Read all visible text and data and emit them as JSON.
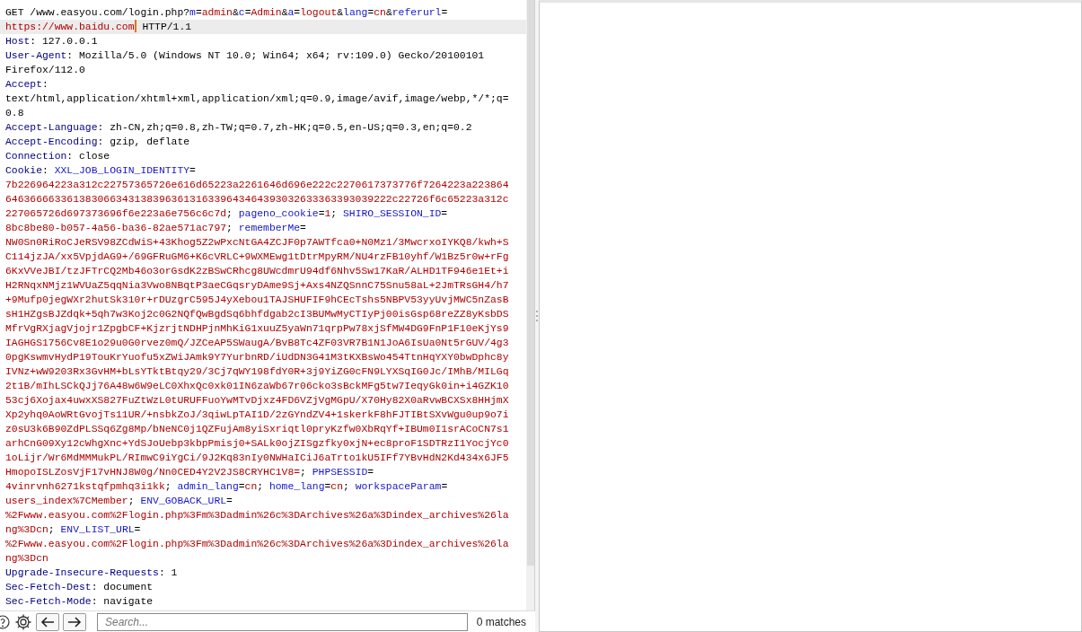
{
  "editor": {
    "lines": [
      {
        "highlighted": false,
        "segments": [
          {
            "kind": "plain",
            "text": "GET /www.easyou.com/login.php?"
          },
          {
            "kind": "name",
            "text": "m"
          },
          {
            "kind": "plain",
            "text": "="
          },
          {
            "kind": "value",
            "text": "admin"
          },
          {
            "kind": "plain",
            "text": "&"
          },
          {
            "kind": "name",
            "text": "c"
          },
          {
            "kind": "plain",
            "text": "="
          },
          {
            "kind": "value",
            "text": "Admin"
          },
          {
            "kind": "plain",
            "text": "&"
          },
          {
            "kind": "name",
            "text": "a"
          },
          {
            "kind": "plain",
            "text": "="
          },
          {
            "kind": "value",
            "text": "logout"
          },
          {
            "kind": "plain",
            "text": "&"
          },
          {
            "kind": "name",
            "text": "lang"
          },
          {
            "kind": "plain",
            "text": "="
          },
          {
            "kind": "value",
            "text": "cn"
          },
          {
            "kind": "plain",
            "text": "&"
          },
          {
            "kind": "name",
            "text": "referurl"
          },
          {
            "kind": "plain",
            "text": "="
          }
        ]
      },
      {
        "highlighted": true,
        "segments": [
          {
            "kind": "value",
            "text": "https://www.baidu.com",
            "cursor_after": true
          },
          {
            "kind": "plain",
            "text": " HTTP/1.1"
          }
        ]
      },
      {
        "highlighted": false,
        "segments": [
          {
            "kind": "header",
            "text": "Host"
          },
          {
            "kind": "plain",
            "text": ": 127.0.0.1"
          }
        ]
      },
      {
        "highlighted": false,
        "segments": [
          {
            "kind": "header",
            "text": "User-Agent"
          },
          {
            "kind": "plain",
            "text": ": Mozilla/5.0 (Windows NT 10.0; Win64; x64; rv:109.0) Gecko/20100101"
          }
        ]
      },
      {
        "highlighted": false,
        "segments": [
          {
            "kind": "plain",
            "text": "Firefox/112.0"
          }
        ]
      },
      {
        "highlighted": false,
        "segments": [
          {
            "kind": "header",
            "text": "Accept"
          },
          {
            "kind": "plain",
            "text": ":"
          }
        ]
      },
      {
        "highlighted": false,
        "segments": [
          {
            "kind": "plain",
            "text": "text/html,application/xhtml+xml,application/xml;q=0.9,image/avif,image/webp,*/*;q="
          }
        ]
      },
      {
        "highlighted": false,
        "segments": [
          {
            "kind": "plain",
            "text": "0.8"
          }
        ]
      },
      {
        "highlighted": false,
        "segments": [
          {
            "kind": "header",
            "text": "Accept-Language"
          },
          {
            "kind": "plain",
            "text": ": zh-CN,zh;q=0.8,zh-TW;q=0.7,zh-HK;q=0.5,en-US;q=0.3,en;q=0.2"
          }
        ]
      },
      {
        "highlighted": false,
        "segments": [
          {
            "kind": "header",
            "text": "Accept-Encoding"
          },
          {
            "kind": "plain",
            "text": ": gzip, deflate"
          }
        ]
      },
      {
        "highlighted": false,
        "segments": [
          {
            "kind": "header",
            "text": "Connection"
          },
          {
            "kind": "plain",
            "text": ": close"
          }
        ]
      },
      {
        "highlighted": false,
        "segments": [
          {
            "kind": "header",
            "text": "Cookie"
          },
          {
            "kind": "plain",
            "text": ": "
          },
          {
            "kind": "name",
            "text": "XXL_JOB_LOGIN_IDENTITY"
          },
          {
            "kind": "plain",
            "text": "="
          }
        ]
      },
      {
        "highlighted": false,
        "segments": [
          {
            "kind": "value",
            "text": "7b226964223a312c22757365726e616d65223a2261646d696e222c2270617373776f7264223a223864"
          }
        ]
      },
      {
        "highlighted": false,
        "segments": [
          {
            "kind": "value",
            "text": "646366663361383066343138396361316339643464393032633363393039222c22726f6c65223a312c"
          }
        ]
      },
      {
        "highlighted": false,
        "segments": [
          {
            "kind": "value",
            "text": "227065726d697373696f6e223a6e756c6c7d"
          },
          {
            "kind": "plain",
            "text": "; "
          },
          {
            "kind": "name",
            "text": "pageno_cookie"
          },
          {
            "kind": "plain",
            "text": "="
          },
          {
            "kind": "value",
            "text": "1"
          },
          {
            "kind": "plain",
            "text": "; "
          },
          {
            "kind": "name",
            "text": "SHIRO_SESSION_ID"
          },
          {
            "kind": "plain",
            "text": "="
          }
        ]
      },
      {
        "highlighted": false,
        "segments": [
          {
            "kind": "value",
            "text": "8bc8be80-b057-4a56-ba36-82ae571ac797"
          },
          {
            "kind": "plain",
            "text": "; "
          },
          {
            "kind": "name",
            "text": "rememberMe"
          },
          {
            "kind": "plain",
            "text": "="
          }
        ]
      },
      {
        "highlighted": false,
        "segments": [
          {
            "kind": "value",
            "text": "NW0Sn0RiRoCJeRSV98ZCdWiS+43Khog5Z2wPxcNtGA4ZCJF0p7AWTfca0+N0Mz1/3MwcrxoIYKQ8/kwh+S"
          }
        ]
      },
      {
        "highlighted": false,
        "segments": [
          {
            "kind": "value",
            "text": "C114jzJA/xx5VpjdAG9+/69GFRuGM6+K6cVRLC+9WXMEwg1tDtrMpyRM/NU4rzFB10yhf/W1Bz5r0w+rFg"
          }
        ]
      },
      {
        "highlighted": false,
        "segments": [
          {
            "kind": "value",
            "text": "6KxVVeJBI/tzJFTrCQ2Mb46o3orGsdK2zBSwCRhcg8UWcdmrU94df6Nhv5Sw17KaR/ALHD1TF946e1Et+i"
          }
        ]
      },
      {
        "highlighted": false,
        "segments": [
          {
            "kind": "value",
            "text": "H2RNqxNMjz1WVUaZ5qqNia3Vwo8NBqtP3aeCGqsryDAme9Sj+Axs4NZQSnnC75Snu58aL+2JmTRsGH4/h7"
          }
        ]
      },
      {
        "highlighted": false,
        "segments": [
          {
            "kind": "value",
            "text": "+9Mufp0jegWXr2hutSk310r+rDUzgrC595J4yXebou1TAJSHUFIF9hCEcTshs5NBPV53yyUvjMWC5nZasB"
          }
        ]
      },
      {
        "highlighted": false,
        "segments": [
          {
            "kind": "value",
            "text": "sH1HZgsBJZdqk+5qh7w3Koj2c0G2NQfQwBgdSq6bhfdgab2cI3BUMwMyCTIyPj00isGsp68reZZ8yKsbDS"
          }
        ]
      },
      {
        "highlighted": false,
        "segments": [
          {
            "kind": "value",
            "text": "MfrVgRXjagVjojr1ZpgbCF+KjzrjtNDHPjnMhKiG1xuuZ5yaWn71qrpPw78xjSfMW4DG9FnP1F10eKjYs9"
          }
        ]
      },
      {
        "highlighted": false,
        "segments": [
          {
            "kind": "value",
            "text": "IAGHGS1756Cv8E1o29u0G0rvez0mQ/JZCeAP5SWaugA/BvB8Tc4ZF03VR7B1N1JoA6IsUa0Nt5rGUV/4g3"
          }
        ]
      },
      {
        "highlighted": false,
        "segments": [
          {
            "kind": "value",
            "text": "0pgKswmvHydP19TouKrYuofu5xZWiJAmk9Y7YurbnRD/iUdDN3G41M3tKXBsWo454TtnHqYXY0bwDphc8y"
          }
        ]
      },
      {
        "highlighted": false,
        "segments": [
          {
            "kind": "value",
            "text": "IVNz+wW9203Rx3GvHM+bLsYTktBtqy29/3Cj7qWY198fdY0R+3j9YiZG0cFN9LYXSqIG0Jc/IMhB/MILGq"
          }
        ]
      },
      {
        "highlighted": false,
        "segments": [
          {
            "kind": "value",
            "text": "2t1B/mIhLSCkQJj76A48w6W9eLC0XhxQc0xk01IN6zaWb67r06cko3sBckMFg5tw7IeqyGk0in+i4GZK10"
          }
        ]
      },
      {
        "highlighted": false,
        "segments": [
          {
            "kind": "value",
            "text": "53cj6Xojax4uwxXS827FuZtWzL0tURUFFuoYwMTvDjxz4FD6VZjVgMGpU/X70Hy82X0aRvwBCXSx8HHjmX"
          }
        ]
      },
      {
        "highlighted": false,
        "segments": [
          {
            "kind": "value",
            "text": "Xp2yhq0AoWRtGvojTs11UR/+nsbkZoJ/3qiwLpTAI1D/2zGYndZV4+1skerkF8hFJTIBtSXvWgu0up9o7i"
          }
        ]
      },
      {
        "highlighted": false,
        "segments": [
          {
            "kind": "value",
            "text": "z0sU3k6B90ZdPLSSq6Zg8Mp/bNeNC0j1QZFujAm8yiSxriqtl0pryKzfw0XbRqYf+IBUm0I1srACoCN7s1"
          }
        ]
      },
      {
        "highlighted": false,
        "segments": [
          {
            "kind": "value",
            "text": "arhCnG09Xy12cWhgXnc+YdSJoUebp3kbpPmisj0+SALk0ojZISgzfky0xjN+ec8proF1SDTRzI1YocjYc0"
          }
        ]
      },
      {
        "highlighted": false,
        "segments": [
          {
            "kind": "value",
            "text": "1oLijr/Wr6MdMMMukPL/RImwC9iYgCi/9J2Kq83nIy0NWHaICiJ6aTrto1kU5IFf7YBvHdN2Kd434x6JF5"
          }
        ]
      },
      {
        "highlighted": false,
        "segments": [
          {
            "kind": "value",
            "text": "HmopoISLZosVjF17vHNJ8W0g/Nn0CED4Y2V2JS8CRYHC1V8="
          },
          {
            "kind": "plain",
            "text": "; "
          },
          {
            "kind": "name",
            "text": "PHPSESSID"
          },
          {
            "kind": "plain",
            "text": "="
          }
        ]
      },
      {
        "highlighted": false,
        "segments": [
          {
            "kind": "value",
            "text": "4vinrvnh6271kstqfpmhq3i1kk"
          },
          {
            "kind": "plain",
            "text": "; "
          },
          {
            "kind": "name",
            "text": "admin_lang"
          },
          {
            "kind": "plain",
            "text": "="
          },
          {
            "kind": "value",
            "text": "cn"
          },
          {
            "kind": "plain",
            "text": "; "
          },
          {
            "kind": "name",
            "text": "home_lang"
          },
          {
            "kind": "plain",
            "text": "="
          },
          {
            "kind": "value",
            "text": "cn"
          },
          {
            "kind": "plain",
            "text": "; "
          },
          {
            "kind": "name",
            "text": "workspaceParam"
          },
          {
            "kind": "plain",
            "text": "="
          }
        ]
      },
      {
        "highlighted": false,
        "segments": [
          {
            "kind": "value",
            "text": "users_index%7CMember"
          },
          {
            "kind": "plain",
            "text": "; "
          },
          {
            "kind": "name",
            "text": "ENV_GOBACK_URL"
          },
          {
            "kind": "plain",
            "text": "="
          }
        ]
      },
      {
        "highlighted": false,
        "segments": [
          {
            "kind": "value",
            "text": "%2Fwww.easyou.com%2Flogin.php%3Fm%3Dadmin%26c%3DArchives%26a%3Dindex_archives%26la"
          }
        ]
      },
      {
        "highlighted": false,
        "segments": [
          {
            "kind": "value",
            "text": "ng%3Dcn"
          },
          {
            "kind": "plain",
            "text": "; "
          },
          {
            "kind": "name",
            "text": "ENV_LIST_URL"
          },
          {
            "kind": "plain",
            "text": "="
          }
        ]
      },
      {
        "highlighted": false,
        "segments": [
          {
            "kind": "value",
            "text": "%2Fwww.easyou.com%2Flogin.php%3Fm%3Dadmin%26c%3DArchives%26a%3Dindex_archives%26la"
          }
        ]
      },
      {
        "highlighted": false,
        "segments": [
          {
            "kind": "value",
            "text": "ng%3Dcn"
          }
        ]
      },
      {
        "highlighted": false,
        "segments": [
          {
            "kind": "header",
            "text": "Upgrade-Insecure-Requests"
          },
          {
            "kind": "plain",
            "text": ": 1"
          }
        ]
      },
      {
        "highlighted": false,
        "segments": [
          {
            "kind": "header",
            "text": "Sec-Fetch-Dest"
          },
          {
            "kind": "plain",
            "text": ": document"
          }
        ]
      },
      {
        "highlighted": false,
        "segments": [
          {
            "kind": "header",
            "text": "Sec-Fetch-Mode"
          },
          {
            "kind": "plain",
            "text": ": navigate"
          }
        ]
      }
    ]
  },
  "search_bar": {
    "placeholder": "Search...",
    "matches": "0 matches"
  }
}
